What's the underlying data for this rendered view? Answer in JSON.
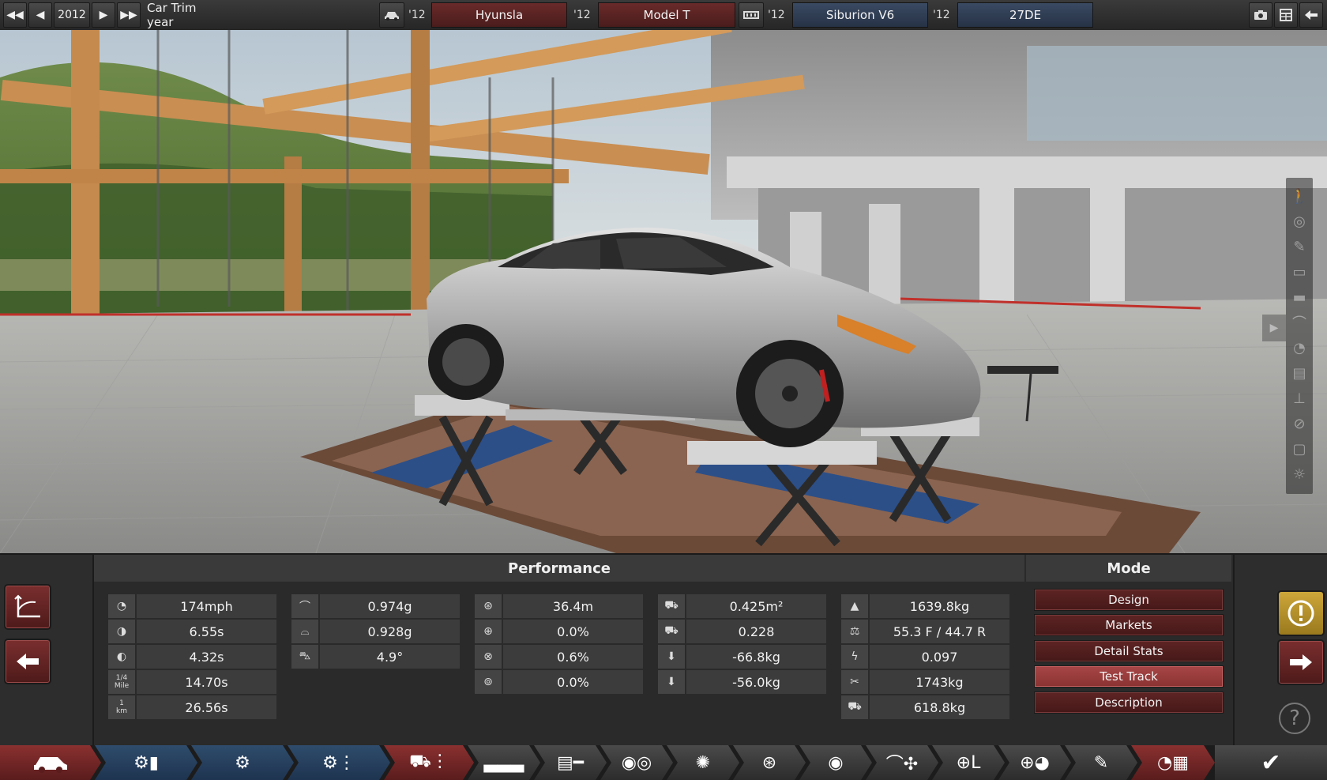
{
  "topbar": {
    "fast_back": "◀◀",
    "back": "◀",
    "year": "2012",
    "forward": "▶",
    "fast_forward": "▶▶",
    "trim_label": "Car Trim year",
    "car_icon": "car-icon",
    "car_year_1": "'12",
    "make": "Hyunsla",
    "car_year_2": "'12",
    "model": "Model T",
    "engine_icon": "engine-icon",
    "engine_year_1": "'12",
    "engine_family": "Siburion V6",
    "engine_year_2": "'12",
    "engine_variant": "27DE"
  },
  "side_toolbar": {
    "icons": [
      "walk-icon",
      "wheel-icon",
      "spray-icon",
      "engine-icon",
      "bar-icon",
      "car-roof-icon",
      "car-side-icon",
      "grille-icon",
      "lift-icon",
      "tire-icon",
      "window-icon",
      "light-icon"
    ]
  },
  "panel": {
    "performance_title": "Performance",
    "stats": {
      "top_speed": "174mph",
      "accel_100": "6.55s",
      "accel_60": "4.32s",
      "quarter_mile_label_1": "1/4",
      "quarter_mile_label_2": "Mile",
      "quarter_mile": "14.70s",
      "km_label_1": "1",
      "km_label_2": "km",
      "km_time": "26.56s",
      "cornering_1": "0.974g",
      "cornering_2": "0.928g",
      "body_roll": "4.9°",
      "braking_dist": "36.4m",
      "brake_fade_1": "0.0%",
      "brake_fade_2": "0.6%",
      "brake_fade_3": "0.0%",
      "frontal_area": "0.425m²",
      "drag_coef": "0.228",
      "downforce_front": "-66.8kg",
      "downforce_rear": "-56.0kg",
      "weight": "1639.8kg",
      "distribution": "55.3 F / 44.7 R",
      "power_ratio": "0.097",
      "max_load": "1743kg",
      "towing": "618.8kg"
    },
    "mode_title": "Mode",
    "mode_buttons": [
      "Design",
      "Markets",
      "Detail Stats",
      "Test Track",
      "Description"
    ],
    "active_mode": "Test Track"
  },
  "tabs": {
    "icons": [
      "car-body-icon",
      "chassis-doc-icon",
      "suspension-icon",
      "drivetrain-icon",
      "car-parts-icon",
      "seats-icon",
      "trim-icon",
      "headlight-icon",
      "gear-icon",
      "wheel-icon",
      "brake-icon",
      "aero-icon",
      "steering-icon",
      "steering-wheel-icon",
      "spray-icon",
      "race-flag-icon",
      "check-icon"
    ]
  },
  "colors": {
    "accent_red": "#8a3030",
    "accent_blue": "#2f4c6c",
    "warning_gold": "#cda63a"
  }
}
